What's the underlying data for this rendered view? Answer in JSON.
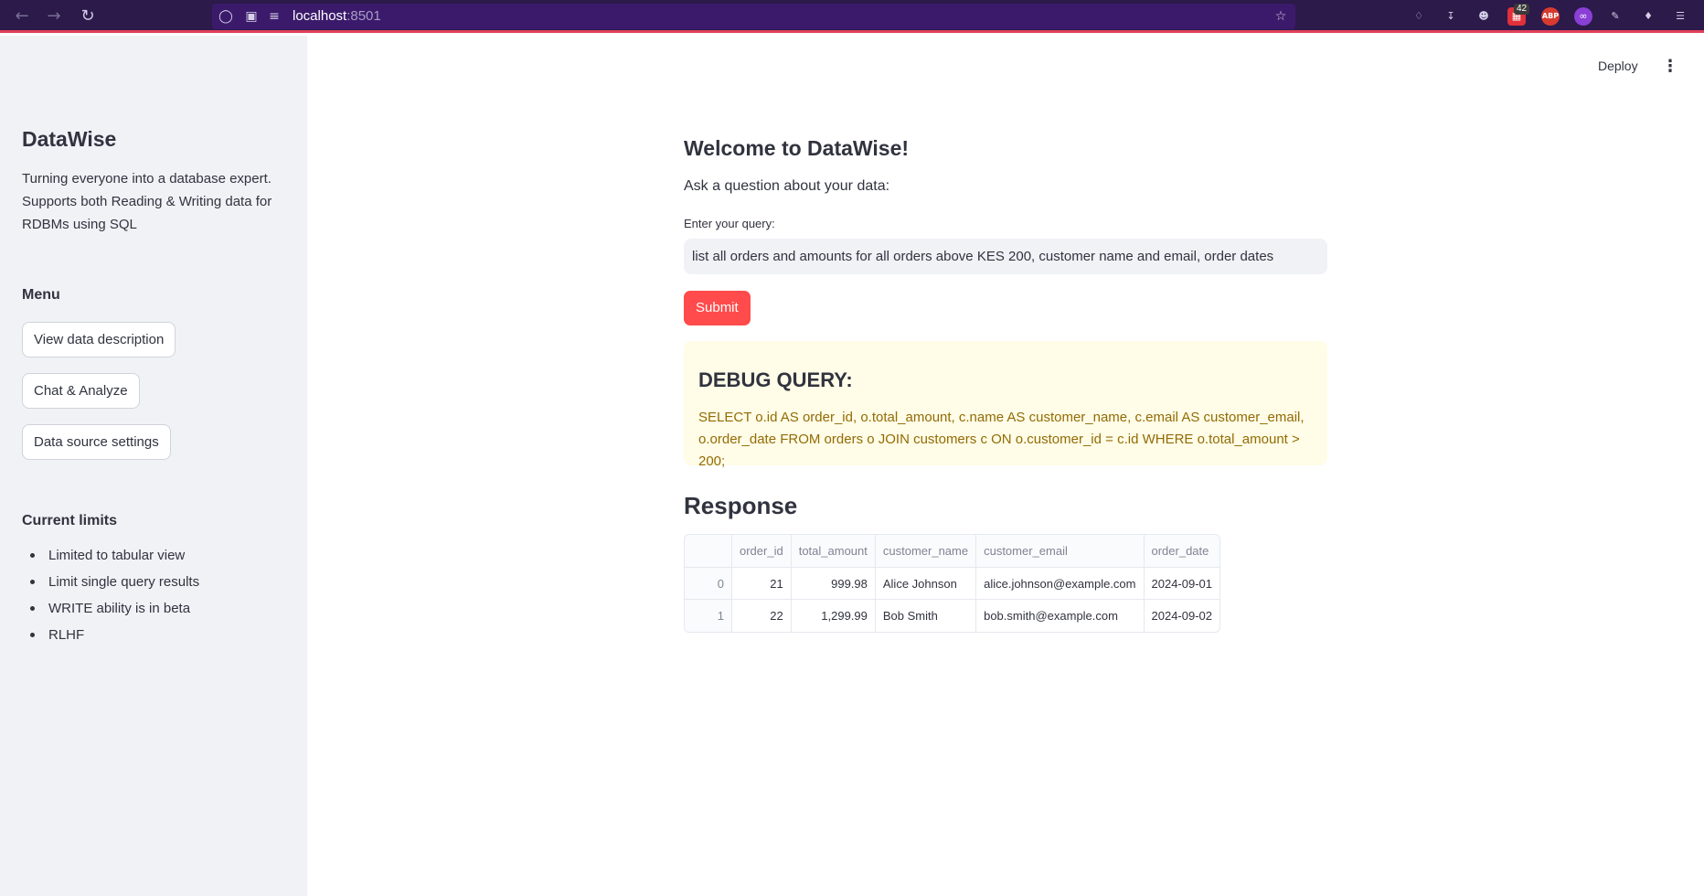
{
  "browser": {
    "url_host": "localhost",
    "url_port": ":8501",
    "extension_badge": "42",
    "abp_label": "ABP"
  },
  "sidebar": {
    "app_title": "DataWise",
    "tagline": "Turning everyone into a database expert. Supports both Reading & Writing data for RDBMs using SQL",
    "menu_title": "Menu",
    "menu_items": [
      {
        "label": "View data description"
      },
      {
        "label": "Chat & Analyze"
      },
      {
        "label": "Data source settings"
      }
    ],
    "limits_title": "Current limits",
    "limits": [
      "Limited to tabular view",
      "Limit single query results",
      "WRITE ability is in beta",
      "RLHF"
    ]
  },
  "toolbar": {
    "deploy_label": "Deploy"
  },
  "main": {
    "welcome": "Welcome to DataWise!",
    "ask_label": "Ask a question about your data:",
    "query_label": "Enter your query:",
    "query_value": "list all orders and amounts for all orders above KES 200, customer name and email, order dates",
    "submit_label": "Submit",
    "debug_title": "DEBUG QUERY:",
    "debug_sql": "SELECT o.id AS order_id, o.total_amount, c.name AS customer_name, c.email AS customer_email, o.order_date FROM orders o JOIN customers c ON o.customer_id = c.id WHERE o.total_amount > 200;",
    "response_title": "Response"
  },
  "table": {
    "columns": [
      "",
      "order_id",
      "total_amount",
      "customer_name",
      "customer_email",
      "order_date"
    ],
    "rows": [
      [
        "0",
        "21",
        "999.98",
        "Alice Johnson",
        "alice.johnson@example.com",
        "2024-09-01"
      ],
      [
        "1",
        "22",
        "1,299.99",
        "Bob Smith",
        "bob.smith@example.com",
        "2024-09-02"
      ]
    ]
  },
  "colors": {
    "primary": "#ff4b4b",
    "sidebar_bg": "#f0f2f6",
    "debug_bg": "#fffce7",
    "debug_text": "#926c05",
    "browser_bg": "#2b1a4a"
  },
  "icons": [
    "back-arrow-icon",
    "forward-arrow-icon",
    "reload-icon",
    "shield-icon",
    "page-icon",
    "site-settings-icon",
    "bookmark-star-icon",
    "pocket-icon",
    "download-icon",
    "account-icon",
    "extensions-icon",
    "menu-icon",
    "kebab-menu-icon"
  ]
}
